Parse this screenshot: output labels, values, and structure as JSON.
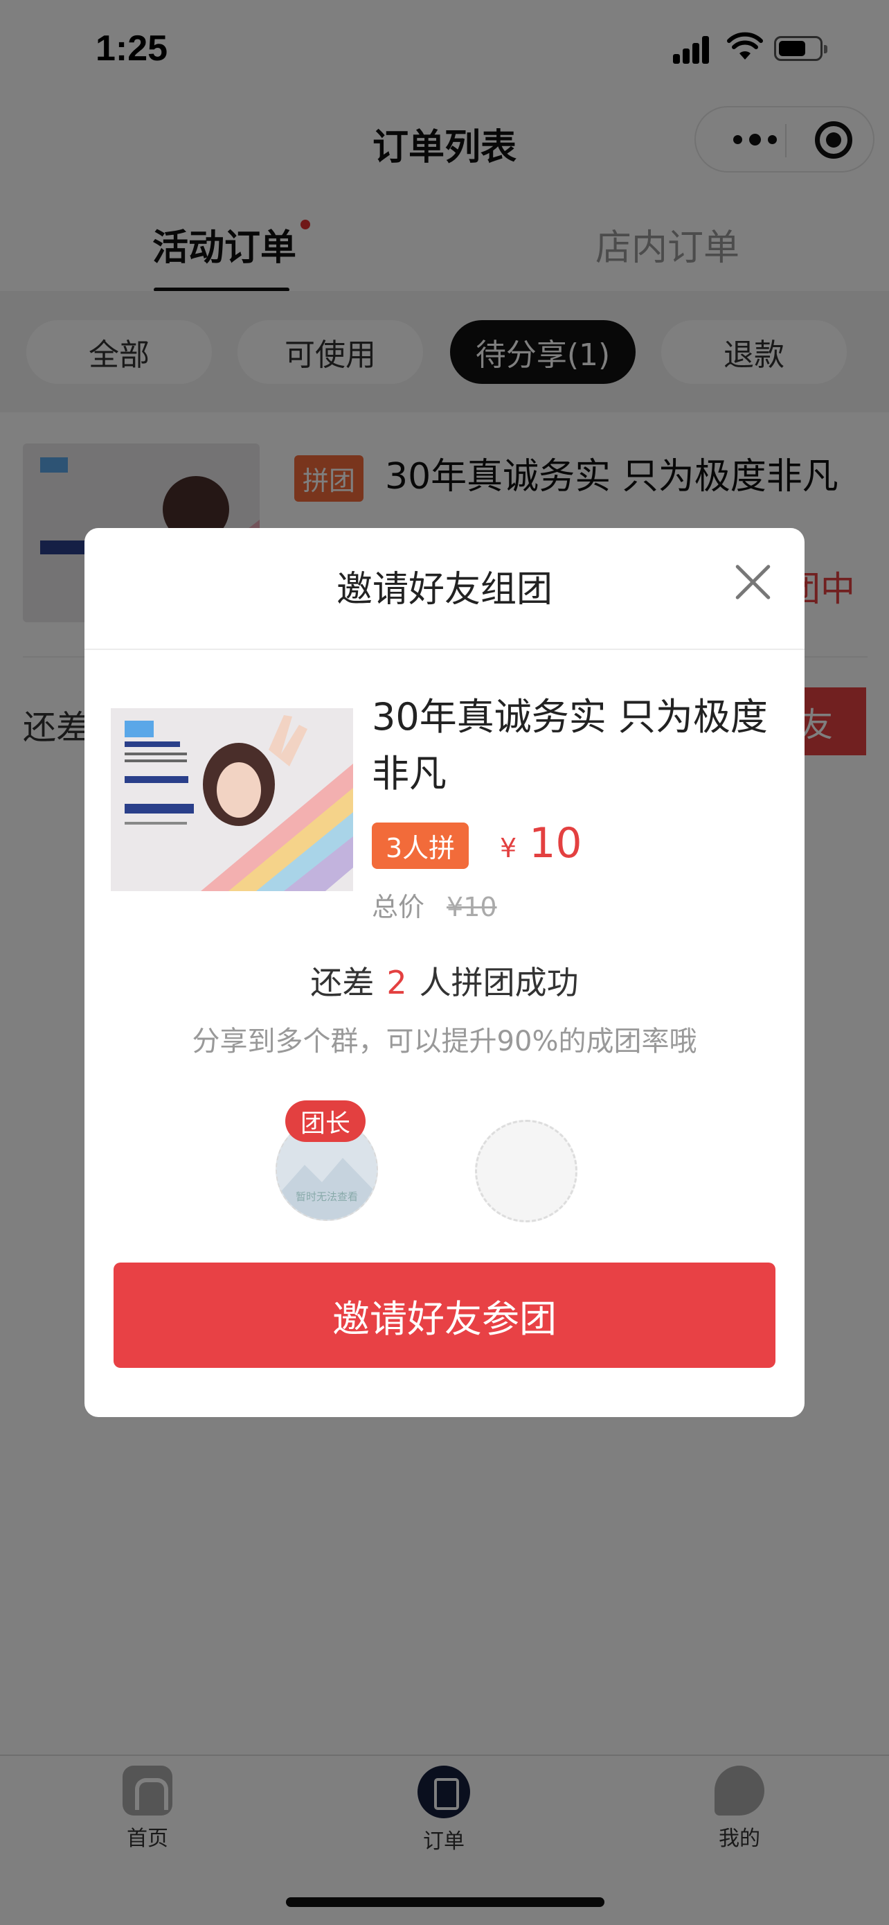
{
  "status_bar": {
    "time": "1:25"
  },
  "nav": {
    "title": "订单列表"
  },
  "tabs": {
    "active": "活动订单",
    "inactive": "店内订单"
  },
  "filters": [
    "全部",
    "可使用",
    "待分享(1)",
    "退款"
  ],
  "order": {
    "tag": "拼团",
    "name": "30年真诚务实 只为极度非凡",
    "status_partial": "团中",
    "left_text_partial": "还差",
    "button_partial": "友"
  },
  "modal": {
    "title": "邀请好友组团",
    "product_name": "30年真诚务实 只为极度非凡",
    "group_badge": "3人拼",
    "price_symbol": "¥",
    "price": "10",
    "total_label": "总价",
    "total_original": "¥10",
    "need_prefix": "还差",
    "need_count": "2",
    "need_suffix": "人拼团成功",
    "hint": "分享到多个群，可以提升90%的成团率哦",
    "leader_label": "团长",
    "leader_avatar_text": "暂时无法查看",
    "invite_button": "邀请好友参团"
  },
  "tabbar": [
    {
      "label": "首页",
      "icon": "home-icon"
    },
    {
      "label": "订单",
      "icon": "order-icon"
    },
    {
      "label": "我的",
      "icon": "profile-icon"
    }
  ],
  "colors": {
    "accent_red": "#e84145",
    "tag_orange": "#f26b3a",
    "dark": "#111111"
  }
}
